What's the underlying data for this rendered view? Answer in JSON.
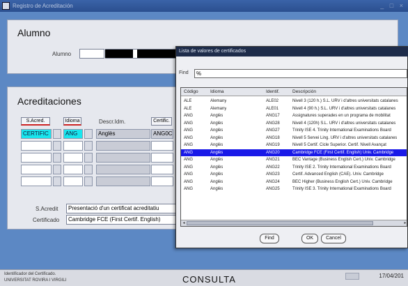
{
  "window": {
    "title": "Registro de Acreditación"
  },
  "alumno": {
    "section_title": "Alumno",
    "label": "Alumno",
    "id_value": "",
    "name_value": ""
  },
  "acreditaciones": {
    "section_title": "Acreditaciones",
    "col_sacred": "S.Acred.",
    "col_idioma": "Idioma",
    "col_descr": "Descr.Idm.",
    "col_certif": "Certific.",
    "rows": [
      {
        "sacred": "CERTIFIC",
        "idioma": "ANG",
        "descr": "Anglès",
        "certif": "ANG0C"
      }
    ],
    "sacredit_label": "S.Acredit",
    "sacredit_value": "Presentació d'un certificat acreditatiu",
    "certificado_label": "Certificado",
    "certificado_value": "Cambridge FCE (First Certif. English)"
  },
  "lov": {
    "title": "Lista de valores de certificados",
    "find_label": "Find",
    "find_value": "%",
    "headers": {
      "codigo": "Código",
      "idioma": "Idioma",
      "identif": "Identif.",
      "descripcion": "Descripción"
    },
    "rows": [
      {
        "codigo": "ALE",
        "idioma": "Alemany",
        "identif": "ALE02",
        "descripcion": "Nivell 3 (120 h.) S.L. URV i d'altres universitats catalanes"
      },
      {
        "codigo": "ALE",
        "idioma": "Alemany",
        "identif": "ALE01",
        "descripcion": "Nivell 4 (90 h.) S.L. URV i d'altres universitats catalanes"
      },
      {
        "codigo": "ANG",
        "idioma": "Anglès",
        "identif": "ANG17",
        "descripcion": "Assignatures superades en un programa de mobilitat"
      },
      {
        "codigo": "ANG",
        "idioma": "Anglès",
        "identif": "ANG28",
        "descripcion": "Nivell 4 (120h) S.L. URV i d'altres universitats catalanes"
      },
      {
        "codigo": "ANG",
        "idioma": "Anglès",
        "identif": "ANG27",
        "descripcion": "Trinity ISE 4. Trinity International Examinations Board"
      },
      {
        "codigo": "ANG",
        "idioma": "Anglès",
        "identif": "ANG18",
        "descripcion": "Nivell 5 Servei Ling. URV i d'altres universitats catalanes"
      },
      {
        "codigo": "ANG",
        "idioma": "Anglès",
        "identif": "ANG19",
        "descripcion": "Nivell 5 Certif. Cicle Superior. Certif. Nivell Avançat"
      },
      {
        "codigo": "ANG",
        "idioma": "Anglès",
        "identif": "ANG20",
        "descripcion": "Cambridge FCE (First Certif. English) Univ. Cambridge"
      },
      {
        "codigo": "ANG",
        "idioma": "Anglès",
        "identif": "ANG21",
        "descripcion": "BEC Vantage (Business English Cert.) Univ. Cambridge"
      },
      {
        "codigo": "ANG",
        "idioma": "Anglès",
        "identif": "ANG22",
        "descripcion": "Trinity ISE 2. Trinity International Examinations Board"
      },
      {
        "codigo": "ANG",
        "idioma": "Anglès",
        "identif": "ANG23",
        "descripcion": "Certif. Advanced English (CAE). Univ. Cambridge"
      },
      {
        "codigo": "ANG",
        "idioma": "Anglès",
        "identif": "ANG24",
        "descripcion": "BEC Higher (Business English Cert.) Univ. Cambridge"
      },
      {
        "codigo": "ANG",
        "idioma": "Anglès",
        "identif": "ANG25",
        "descripcion": "Trinity ISE 3. Trinity International Examinations Board"
      }
    ],
    "selected_index": 7,
    "buttons": {
      "find": "Find",
      "ok": "OK",
      "cancel": "Cancel"
    }
  },
  "status": {
    "line1": "Identificador del Certificado.",
    "line2": "UNIVERSITAT ROVIRA I VIRGILI",
    "mode": "CONSULTA",
    "date": "17/04/201"
  },
  "colors": {
    "desktop": "#5c88c4",
    "selected_row": "#1a1ae8",
    "current_field": "#18e6ee",
    "title_bar": "#1e2c4a"
  }
}
